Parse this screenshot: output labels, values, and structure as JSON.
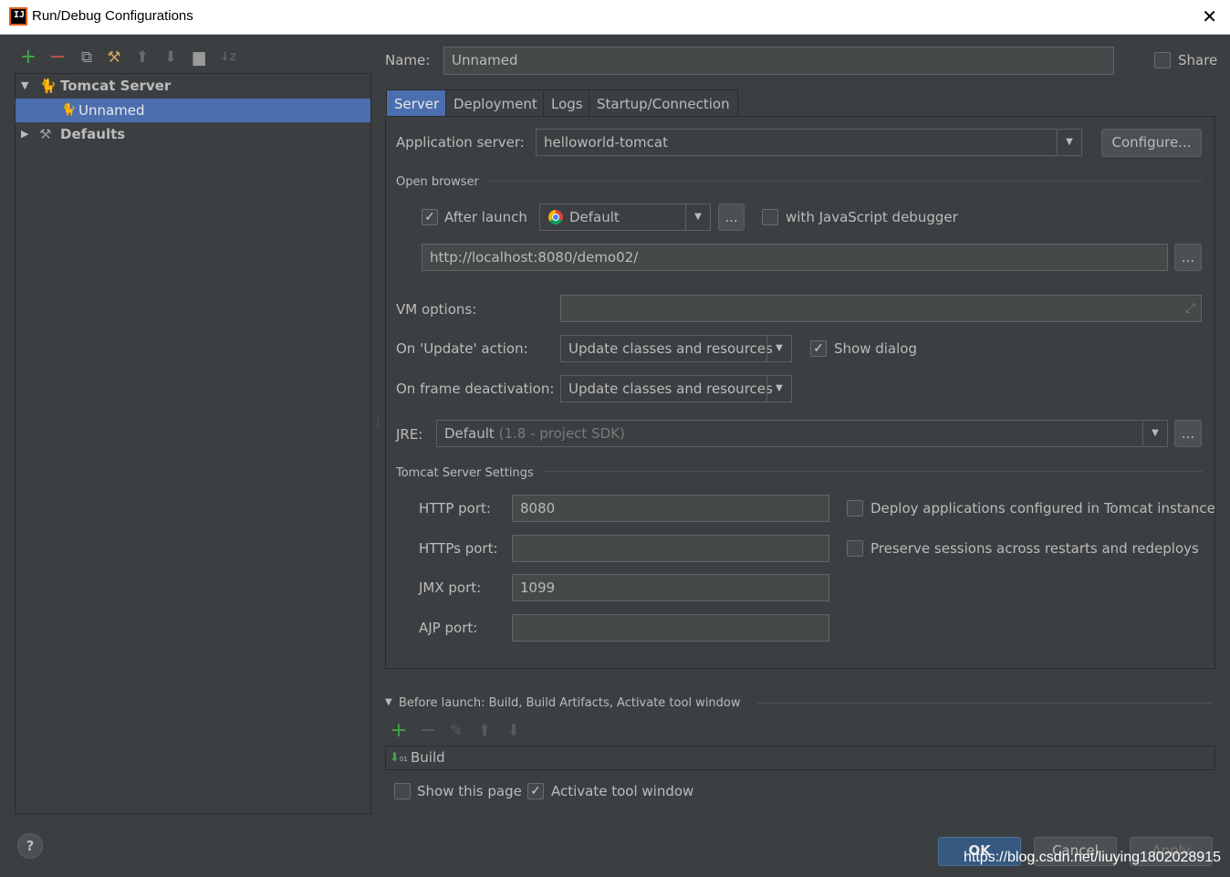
{
  "window": {
    "title": "Run/Debug Configurations"
  },
  "toolbar": {
    "icons": [
      "add-icon",
      "remove-icon",
      "copy-icon",
      "wrench-icon",
      "arrow-up-icon",
      "arrow-down-icon",
      "folder-icon",
      "sort-icon"
    ]
  },
  "tree": {
    "items": [
      {
        "label": "Tomcat Server",
        "expanded": true
      },
      {
        "label": "Unnamed",
        "selected": true
      },
      {
        "label": "Defaults",
        "expanded": false
      }
    ]
  },
  "name": {
    "label": "Name:",
    "value": "Unnamed",
    "share_label": "Share"
  },
  "tabs": [
    "Server",
    "Deployment",
    "Logs",
    "Startup/Connection"
  ],
  "server": {
    "app_server_label": "Application server:",
    "app_server_value": "helloworld-tomcat",
    "configure_label": "Configure...",
    "open_browser_label": "Open browser",
    "after_launch_label": "After launch",
    "browser_value": "Default",
    "ellipsis": "...",
    "js_debugger_label": "with JavaScript debugger",
    "url_value": "http://localhost:8080/demo02/",
    "vm_options_label": "VM options:",
    "on_update_label": "On 'Update' action:",
    "on_update_value": "Update classes and resources",
    "show_dialog_label": "Show dialog",
    "on_frame_label": "On frame deactivation:",
    "on_frame_value": "Update classes and resources",
    "jre_label": "JRE:",
    "jre_value": "Default",
    "jre_hint": "(1.8 - project SDK)",
    "tomcat_settings_label": "Tomcat Server Settings",
    "http_port_label": "HTTP port:",
    "http_port_value": "8080",
    "https_port_label": "HTTPs port:",
    "https_port_value": "",
    "jmx_port_label": "JMX port:",
    "jmx_port_value": "1099",
    "ajp_port_label": "AJP port:",
    "ajp_port_value": "",
    "deploy_apps_label": "Deploy applications configured in Tomcat instance",
    "preserve_sessions_label": "Preserve sessions across restarts and redeploys"
  },
  "before_launch": {
    "title": "Before launch: Build, Build Artifacts, Activate tool window",
    "item": "Build",
    "show_page_label": "Show this page",
    "activate_label": "Activate tool window"
  },
  "footer": {
    "help": "?",
    "ok": "OK",
    "cancel": "Cancel",
    "apply": "Apply",
    "watermark": "https://blog.csdn.net/liuying1802028915"
  },
  "colors": {
    "background": "#3c3f41",
    "selection": "#4b6eaf",
    "add_green": "#3fa54a",
    "remove_red": "#c75450"
  }
}
